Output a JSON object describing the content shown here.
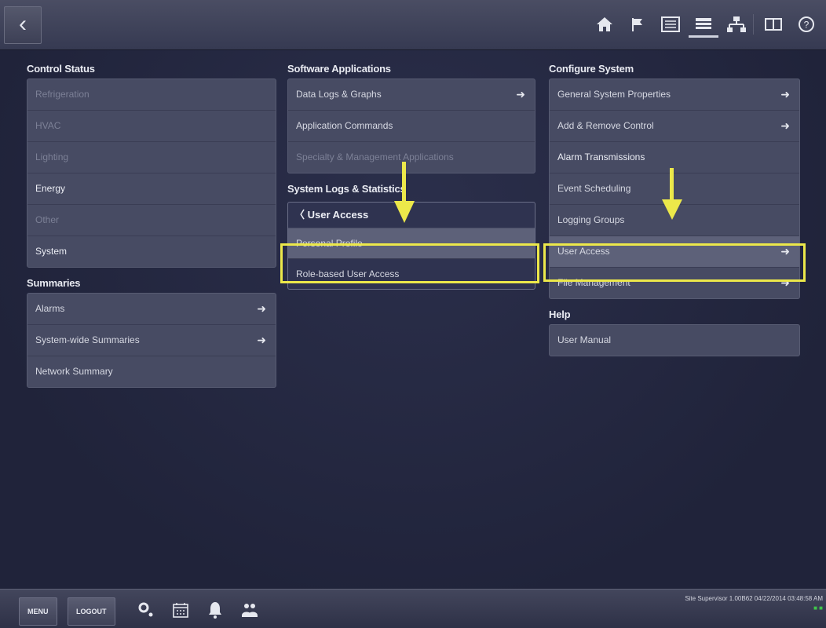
{
  "colors": {
    "accent_highlight": "#ece84a",
    "background": "#23263f",
    "panel": "#474b63"
  },
  "topbar": {
    "back_icon": "chevron-left-icon",
    "icons": [
      "home-icon",
      "flag-icon",
      "grid-icon",
      "list-icon",
      "network-icon",
      "panels-icon",
      "help-icon"
    ]
  },
  "control_status": {
    "title": "Control Status",
    "items": [
      "Refrigeration",
      "HVAC",
      "Lighting",
      "Energy",
      "Other",
      "System"
    ]
  },
  "summaries": {
    "title": "Summaries",
    "items": [
      "Alarms",
      "System-wide Summaries",
      "Network Summary"
    ]
  },
  "software_applications": {
    "title": "Software Applications",
    "items": [
      "Data Logs & Graphs",
      "Application Commands",
      "Specialty & Management Applications"
    ]
  },
  "system_logs": {
    "title": "System Logs & Statistics"
  },
  "user_access_panel": {
    "title": "User Access",
    "items": [
      "Personal Profile",
      "Role-based User Access"
    ]
  },
  "configure_system": {
    "title": "Configure System",
    "items": [
      "General System Properties",
      "Add & Remove Control",
      "Alarm Transmissions",
      "Event Scheduling",
      "Logging Groups",
      "User Access",
      "File Management"
    ]
  },
  "help": {
    "title": "Help",
    "items": [
      "User Manual"
    ]
  },
  "bottombar": {
    "menu_label": "MENU",
    "logout_label": "LOGOUT",
    "status_line": "Site Supervisor 1.00B62 04/22/2014 03:48:58 AM"
  }
}
